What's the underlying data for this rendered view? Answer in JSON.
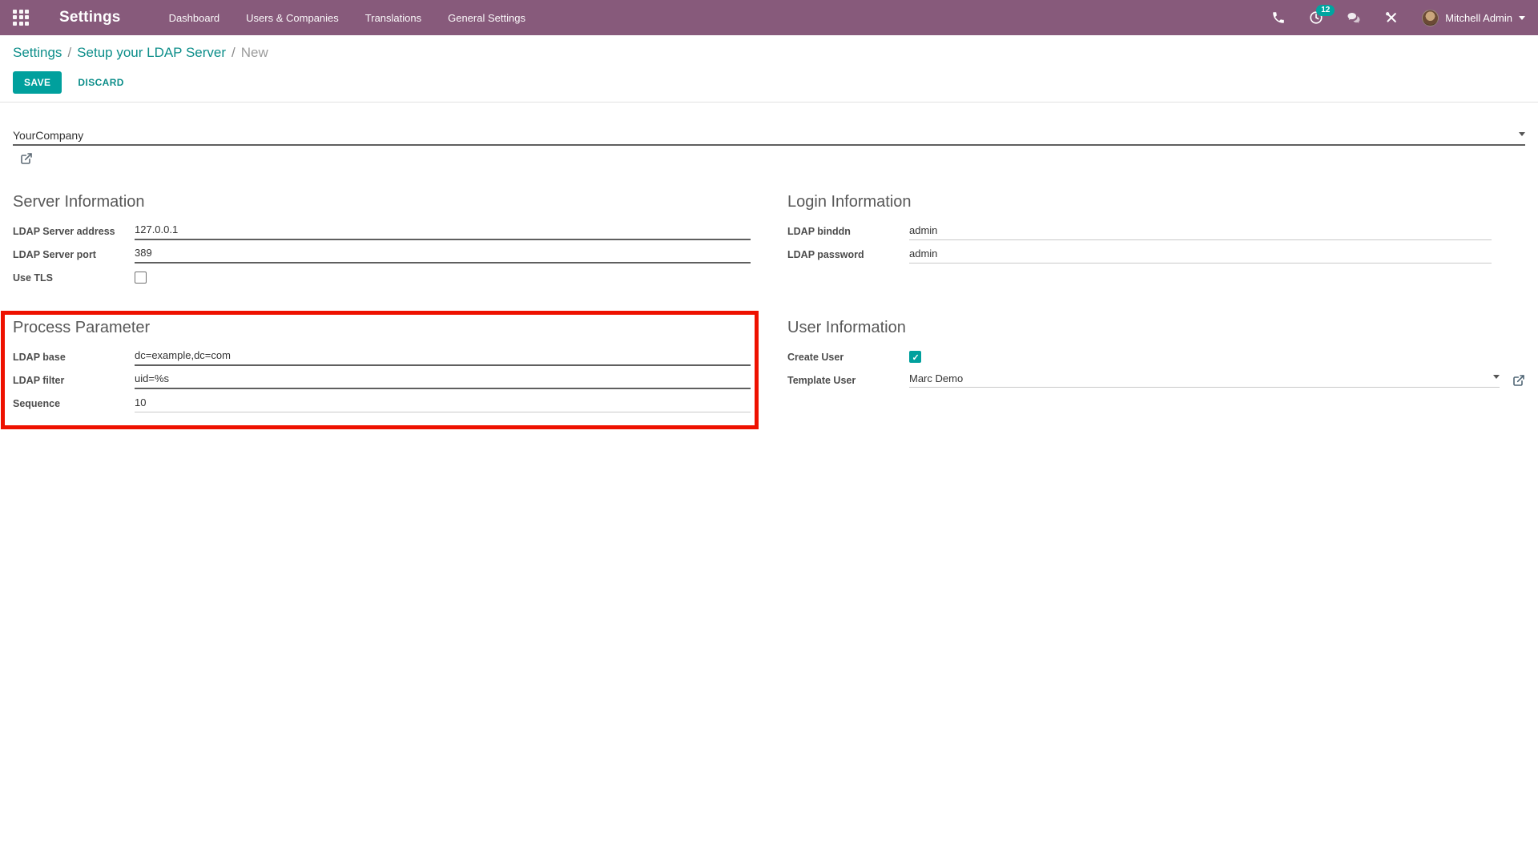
{
  "navbar": {
    "title": "Settings",
    "menu": [
      "Dashboard",
      "Users & Companies",
      "Translations",
      "General Settings"
    ],
    "activity_count": "12",
    "user_name": "Mitchell Admin"
  },
  "breadcrumb": {
    "link1": "Settings",
    "link2": "Setup your LDAP Server",
    "current": "New",
    "separator": "/"
  },
  "actions": {
    "save": "SAVE",
    "discard": "DISCARD"
  },
  "form": {
    "company_value": "YourCompany",
    "server_info": {
      "title": "Server Information",
      "address_label": "LDAP Server address",
      "address_value": "127.0.0.1",
      "port_label": "LDAP Server port",
      "port_value": "389",
      "tls_label": "Use TLS",
      "tls_checked": false
    },
    "login_info": {
      "title": "Login Information",
      "binddn_label": "LDAP binddn",
      "binddn_value": "admin",
      "password_label": "LDAP password",
      "password_value": "admin"
    },
    "process_param": {
      "title": "Process Parameter",
      "base_label": "LDAP base",
      "base_value": "dc=example,dc=com",
      "filter_label": "LDAP filter",
      "filter_value": "uid=%s",
      "sequence_label": "Sequence",
      "sequence_value": "10"
    },
    "user_info": {
      "title": "User Information",
      "create_user_label": "Create User",
      "create_user_checked": true,
      "template_user_label": "Template User",
      "template_user_value": "Marc Demo"
    }
  },
  "icons": {
    "apps": "3x3-grid",
    "phone": "handset",
    "activity": "clock",
    "messages": "chat-bubbles",
    "debug": "crossed-tools",
    "caret_down": "▾",
    "external_link": "box-arrow-out",
    "check": "✓"
  },
  "colors": {
    "navbar_bg": "#875A7B",
    "accent_teal": "#00A09D",
    "breadcrumb_link": "#0d8e8a",
    "annotation_red": "#ee1100"
  }
}
